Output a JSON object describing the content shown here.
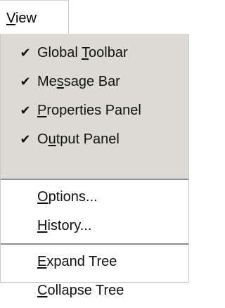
{
  "menubar": {
    "view": {
      "pre": "",
      "mn": "V",
      "post": "iew"
    }
  },
  "menu": {
    "check_items": [
      {
        "check": "✔",
        "pre": "Global ",
        "mn": "T",
        "post": "oolbar"
      },
      {
        "check": "✔",
        "pre": "Me",
        "mn": "s",
        "post": "sage Bar"
      },
      {
        "check": "✔",
        "pre": "",
        "mn": "P",
        "post": "roperties Panel"
      },
      {
        "check": "✔",
        "pre": "O",
        "mn": "u",
        "post": "tput Panel"
      }
    ],
    "group2": [
      {
        "pre": "",
        "mn": "O",
        "post": "ptions..."
      },
      {
        "pre": "",
        "mn": "H",
        "post": "istory..."
      }
    ],
    "group3": [
      {
        "pre": "",
        "mn": "E",
        "post": "xpand Tree"
      },
      {
        "pre": "",
        "mn": "C",
        "post": "ollapse Tree"
      }
    ]
  }
}
